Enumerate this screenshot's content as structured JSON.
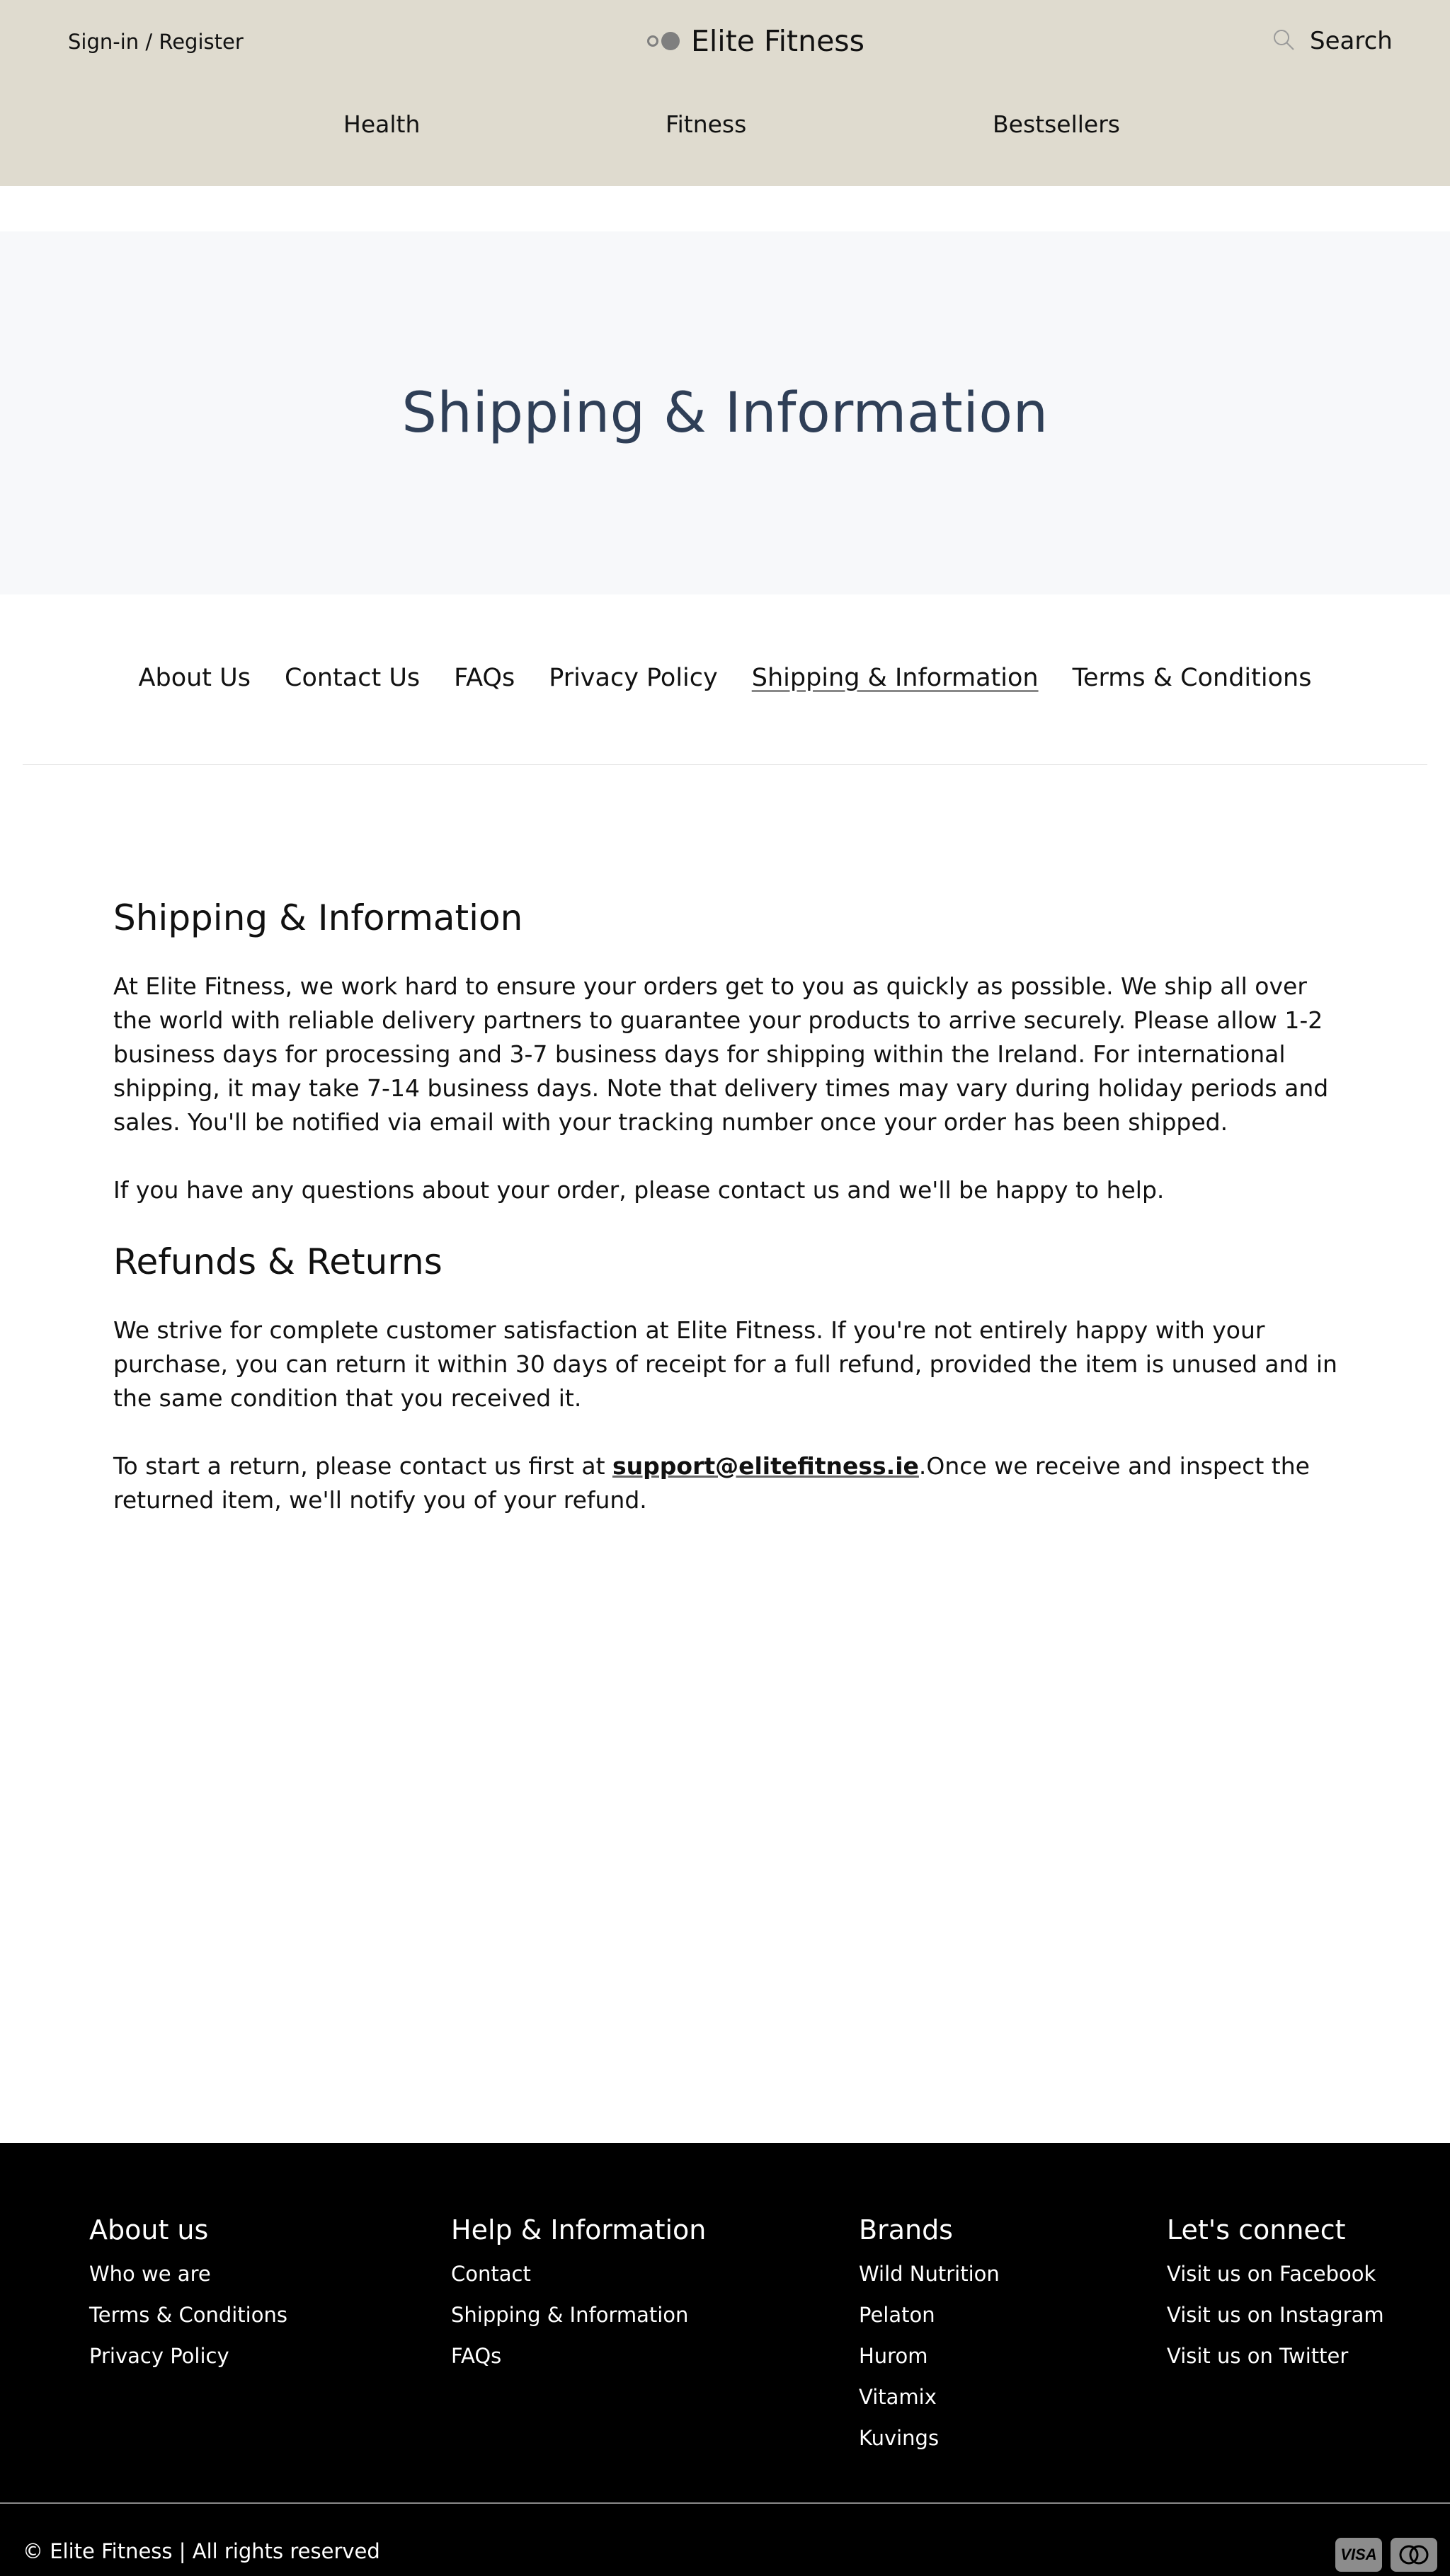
{
  "header": {
    "signin_label": "Sign-in / Register",
    "logo_text": "Elite Fitness",
    "search_label": "Search",
    "nav": [
      "Health",
      "Fitness",
      "Bestsellers"
    ]
  },
  "hero": {
    "title": "Shipping & Information"
  },
  "subnav": [
    "About Us",
    "Contact Us",
    "FAQs",
    "Privacy Policy",
    "Shipping & Information",
    "Terms & Conditions"
  ],
  "active_subnav": "Shipping & Information",
  "content": {
    "shipping_heading": "Shipping & Information",
    "shipping_p1": "At Elite Fitness, we work hard to ensure your orders get to you as quickly as possible. We ship all over the world with reliable delivery partners to guarantee your products to arrive securely. Please allow 1-2 business days for processing and 3-7 business days for shipping within the Ireland. For international shipping, it may take 7-14 business days. Note that delivery times may vary during holiday periods and sales. You'll be notified via email with your tracking number once your order has been shipped.",
    "shipping_p2": "If you have any questions about your order, please contact us and we'll be happy to help.",
    "refunds_heading": "Refunds & Returns",
    "refunds_p1": "We strive for complete customer satisfaction at Elite Fitness. If you're not entirely happy with your purchase, you can return it within 30 days of receipt for a full refund, provided the item is unused and in the same condition that you received it.",
    "refunds_p2_before": "To start a return, please contact us first at ",
    "refunds_email": "support@elitefitness.ie",
    "refunds_p2_after": ".Once we receive and inspect the returned item, we'll notify you of your refund."
  },
  "footer": {
    "columns": [
      {
        "heading": "About us",
        "links": [
          "Who we are",
          "Terms & Conditions",
          "Privacy Policy"
        ]
      },
      {
        "heading": "Help & Information",
        "links": [
          "Contact",
          "Shipping & Information",
          "FAQs"
        ]
      },
      {
        "heading": "Brands",
        "links": [
          "Wild Nutrition",
          "Pelaton",
          "Hurom",
          "Vitamix",
          "Kuvings"
        ]
      },
      {
        "heading": "Let's connect",
        "links": [
          "Visit us on Facebook",
          "Visit us on Instagram",
          "Visit us on Twitter"
        ]
      }
    ],
    "copyright": "© Elite Fitness | All rights reserved",
    "payment_visa_label": "VISA",
    "payment_icons": [
      "visa-icon",
      "mastercard-icon"
    ]
  },
  "colors": {
    "header_bg": "#dfdbcf",
    "hero_bg": "#f7f8fa",
    "hero_title": "#2f3f57",
    "footer_bg": "#000000",
    "payment_icon": "#8c8c8c"
  }
}
